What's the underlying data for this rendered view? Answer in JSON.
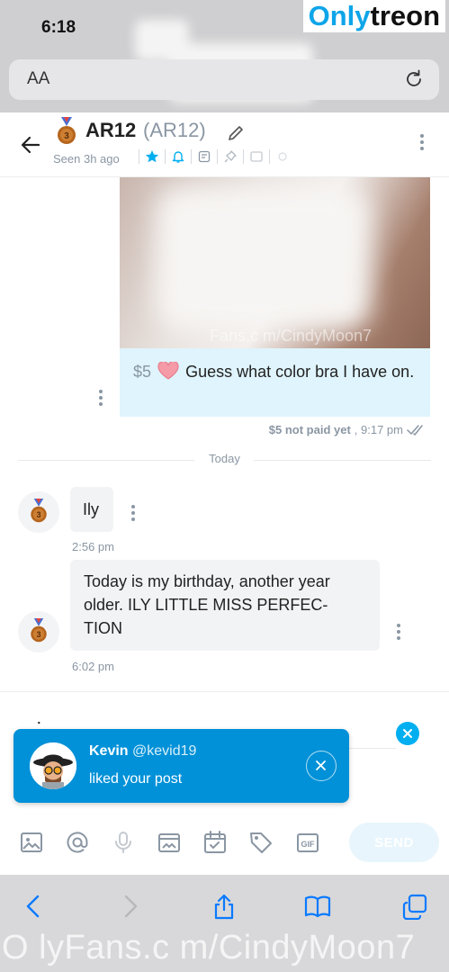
{
  "status_bar": {
    "time": "6:18"
  },
  "watermark": {
    "brand_a": "Only",
    "brand_b": "treon",
    "media_text": "Fans.c m/CindyMoon7",
    "bottom_text": "O lyFans.c m/CindyMoon7"
  },
  "browser": {
    "text_size_label": "AA",
    "icons": [
      "reload-icon",
      "back-icon",
      "forward-icon",
      "share-icon",
      "bookmarks-icon",
      "tabs-icon"
    ]
  },
  "header": {
    "name": "AR12",
    "handle": "(AR12)",
    "seen": "Seen 3h ago",
    "icons": [
      "back-arrow-icon",
      "medal-icon",
      "edit-icon",
      "star-icon",
      "bell-icon",
      "notes-icon",
      "pin-icon",
      "image-icon",
      "more-icon"
    ],
    "accent": "#00aff0"
  },
  "messages": {
    "paid": {
      "price": "$5",
      "text": "Guess what color bra I have on.",
      "status": "$5 not paid yet",
      "time": ", 9:17 pm"
    },
    "day_label": "Today",
    "incoming": [
      {
        "text": "Ily",
        "time": "2:56 pm"
      },
      {
        "text": "Today is my birthday, another year older. ILY LITTLE MISS PERFECTION",
        "line1": "Today is my birthday, another year",
        "line2": "older. ILY LITTLE MISS PERFEC-",
        "line3": "TION",
        "time": "6:02 pm"
      }
    ]
  },
  "composer": {
    "typing_indicator": ".:.",
    "tools": [
      "image-icon",
      "mention-icon",
      "mic-icon",
      "media-icon",
      "calendar-icon",
      "price-tag-icon",
      "gif-icon"
    ],
    "send_label": "SEND"
  },
  "toast": {
    "name": "Kevin",
    "handle": "@kevid19",
    "text": "liked your post"
  },
  "colors": {
    "accent": "#00aff0",
    "toast_bg": "#0091d8",
    "paid_bubble": "#dff4fc",
    "bubble": "#f2f3f5"
  }
}
